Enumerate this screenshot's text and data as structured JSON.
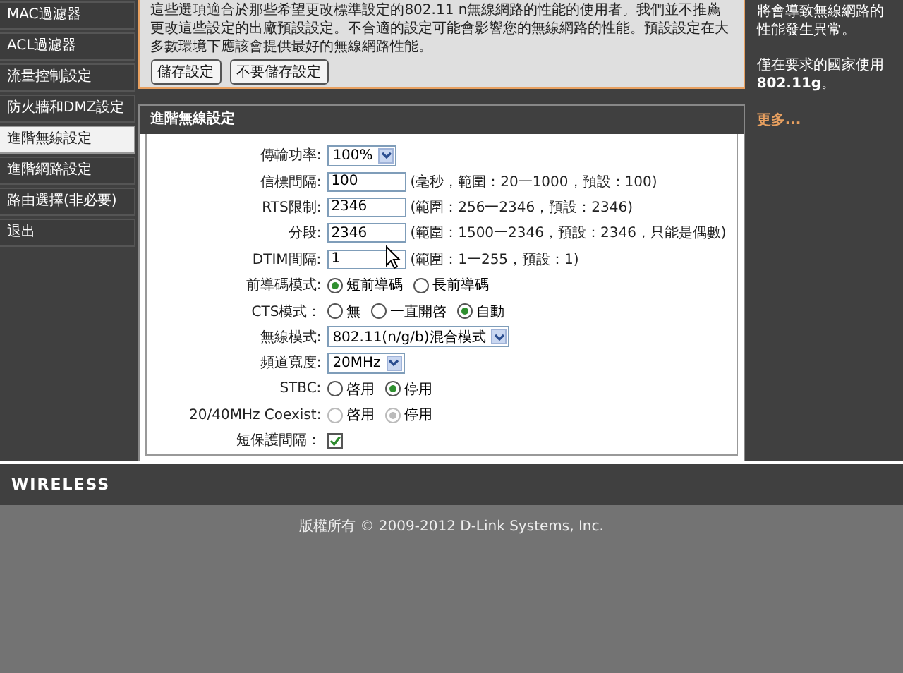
{
  "menu": [
    {
      "label": "MAC過濾器",
      "selected": false
    },
    {
      "label": "ACL過濾器",
      "selected": false
    },
    {
      "label": "流量控制設定",
      "selected": false
    },
    {
      "label": "防火牆和DMZ設定",
      "selected": false
    },
    {
      "label": "進階無線設定",
      "selected": true
    },
    {
      "label": "進階網路設定",
      "selected": false
    },
    {
      "label": "路由選擇(非必要)",
      "selected": false
    },
    {
      "label": "退出",
      "selected": false
    }
  ],
  "intro": {
    "text": "這些選項適合於那些希望更改標準設定的802.11 n無線網路的性能的使用者。我們並不推薦更改這些設定的出廠預設設定。不合適的設定可能會影響您的無線網路的性能。預設設定在大多數環境下應該會提供最好的無線網路性能。",
    "buttons": [
      "儲存設定",
      "不要儲存設定"
    ]
  },
  "section": {
    "title": "進階無線設定",
    "rows": [
      {
        "kind": "select",
        "label": "傳輸功率:",
        "value": "100%"
      },
      {
        "kind": "text",
        "label": "信標間隔:",
        "value": "100",
        "hint": "(毫秒，範圍：20一1000，預設：100)"
      },
      {
        "kind": "text",
        "label": "RTS限制:",
        "value": "2346",
        "hint": "(範圍：256一2346，預設：2346)"
      },
      {
        "kind": "text",
        "label": "分段:",
        "value": "2346",
        "hint": "(範圍：1500一2346，預設：2346，只能是偶數)"
      },
      {
        "kind": "text",
        "label": "DTIM間隔:",
        "value": "1",
        "hint": "(範圍：1一255，預設：1)"
      },
      {
        "kind": "radio",
        "label": "前導碼模式:",
        "options": [
          {
            "label": "短前導碼",
            "selected": true,
            "disabled": false
          },
          {
            "label": "長前導碼",
            "selected": false,
            "disabled": false
          }
        ]
      },
      {
        "kind": "radio",
        "label": "CTS模式：",
        "options": [
          {
            "label": "無",
            "selected": false,
            "disabled": false
          },
          {
            "label": "一直開啓",
            "selected": false,
            "disabled": false
          },
          {
            "label": "自動",
            "selected": true,
            "disabled": false
          }
        ]
      },
      {
        "kind": "select",
        "label": "無線模式:",
        "value": "802.11(n/g/b)混合模式"
      },
      {
        "kind": "select",
        "label": "頻道寬度:",
        "value": "20MHz"
      },
      {
        "kind": "radio",
        "label": "STBC:",
        "options": [
          {
            "label": "啓用",
            "selected": false,
            "disabled": false
          },
          {
            "label": "停用",
            "selected": true,
            "disabled": false
          }
        ]
      },
      {
        "kind": "radio",
        "label": "20/40MHz Coexist:",
        "options": [
          {
            "label": "啓用",
            "selected": false,
            "disabled": true
          },
          {
            "label": "停用",
            "selected": true,
            "disabled": true
          }
        ]
      },
      {
        "kind": "checkbox",
        "label": "短保護間隔：",
        "checked": true
      }
    ]
  },
  "help": {
    "lines": [
      "將會導致無線網路的性能發生異常。",
      "僅在要求的國家使用**802.11g**。"
    ],
    "link": "更多..."
  },
  "brand": "WIRELESS",
  "footer": "版權所有 © 2009-2012 D-Link Systems, Inc."
}
